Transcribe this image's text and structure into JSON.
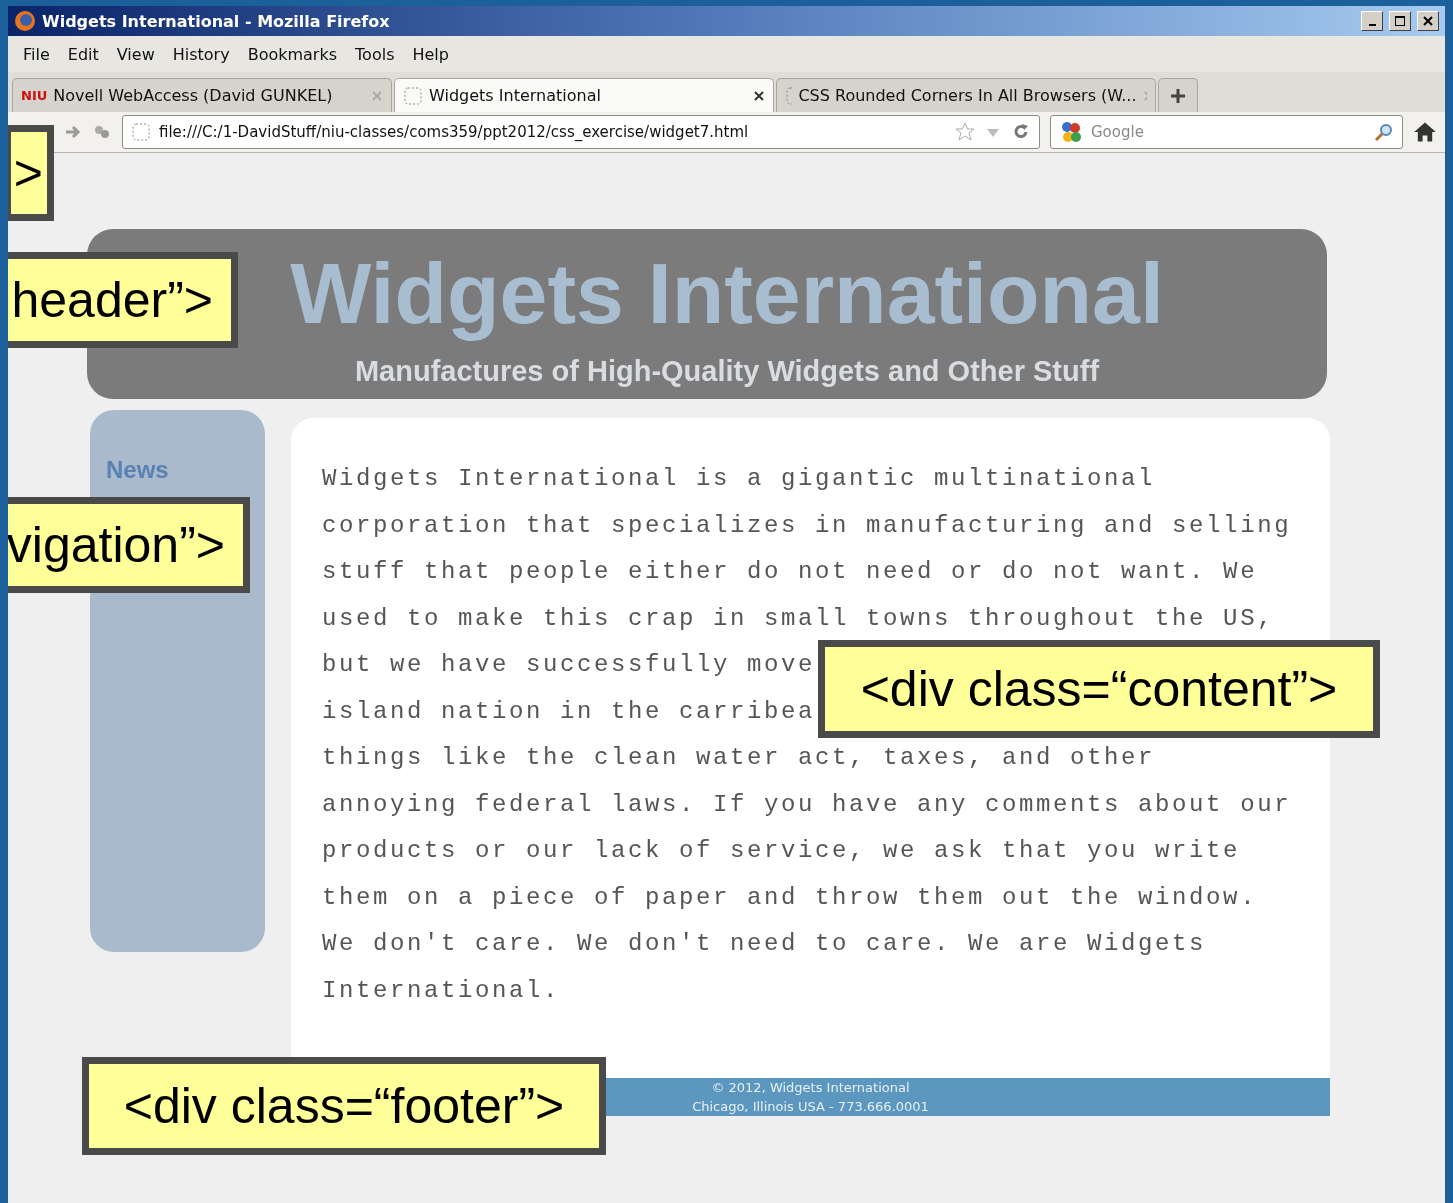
{
  "window": {
    "title": "Widgets International - Mozilla Firefox"
  },
  "menu": [
    "File",
    "Edit",
    "View",
    "History",
    "Bookmarks",
    "Tools",
    "Help"
  ],
  "tabs": [
    {
      "label": "Novell WebAccess (David GUNKEL)",
      "favicon_text": "NIU",
      "selected": false
    },
    {
      "label": "Widgets International",
      "selected": true
    },
    {
      "label": "CSS Rounded Corners In All Browsers (W...",
      "selected": false
    }
  ],
  "address_bar": {
    "value": "file:///C:/1-DavidStuff/niu-classes/coms359/ppt2012/css_exercise/widget7.html"
  },
  "search": {
    "placeholder": "Google"
  },
  "page": {
    "header": {
      "title": "Widgets International",
      "subtitle": "Manufactures of High-Quality Widgets and Other Stuff"
    },
    "navigation": [
      "News"
    ],
    "content": {
      "lines": [
        "Widgets International is a gigantic multinational",
        "corporation that specializes in manufacturing and selling",
        "stuff that people either do not need or do not want. We",
        "used to make this crap in small towns throughout the US,",
        "but we have successfully move",
        "island nation in the carribea",
        "things like the clean water act, taxes, and other",
        "annoying federal laws. If you have any comments about our",
        "products or our lack of service, we ask that you write",
        "them on a piece of paper and throw them out the window.",
        "We don't care. We don't need to care. We are Widgets",
        "International."
      ]
    },
    "footer": {
      "lines": [
        "© 2012, Widgets International",
        "Chicago, Illinois USA - 773.666.0001"
      ]
    }
  },
  "callouts": [
    {
      "text": ">"
    },
    {
      "text": "header”>"
    },
    {
      "text": "vigation”>"
    },
    {
      "text": "<div class=“content”>"
    },
    {
      "text": "<div class=“footer”>"
    }
  ]
}
